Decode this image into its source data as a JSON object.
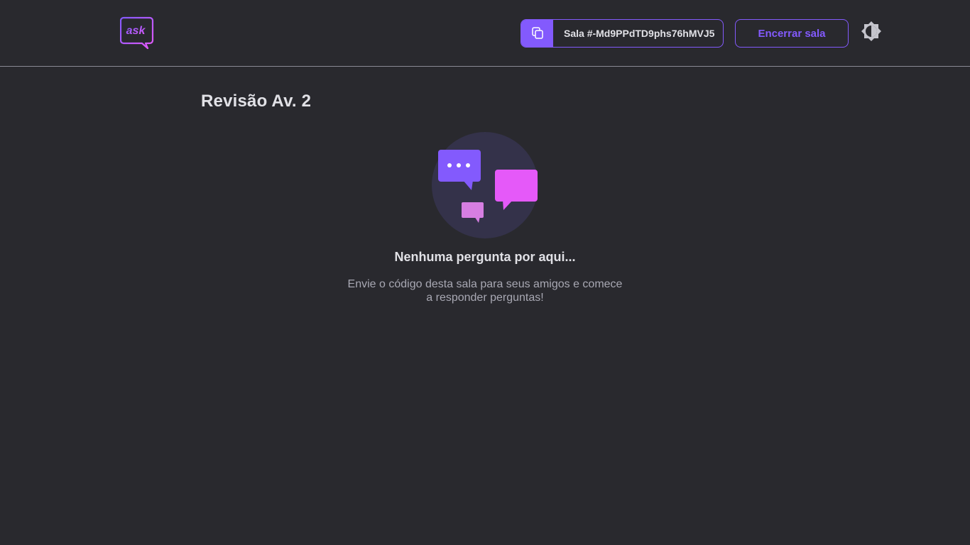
{
  "header": {
    "logo_text": "ask",
    "room_code_label": "Sala #-Md9PPdTD9phs76hMVJ5",
    "close_room_label": "Encerrar sala"
  },
  "room": {
    "title": "Revisão Av. 2"
  },
  "empty_state": {
    "title": "Nenhuma pergunta por aqui...",
    "description": "Envie o código desta sala para seus amigos e comece a responder perguntas!"
  },
  "colors": {
    "background": "#29292e",
    "accent": "#835afd",
    "accent_pink": "#e559f9",
    "text": "#e1e1e6",
    "muted_text": "#a8a8b3"
  },
  "icons": {
    "copy": "copy-icon",
    "theme": "theme-toggle-icon",
    "logo": "logo-icon"
  }
}
